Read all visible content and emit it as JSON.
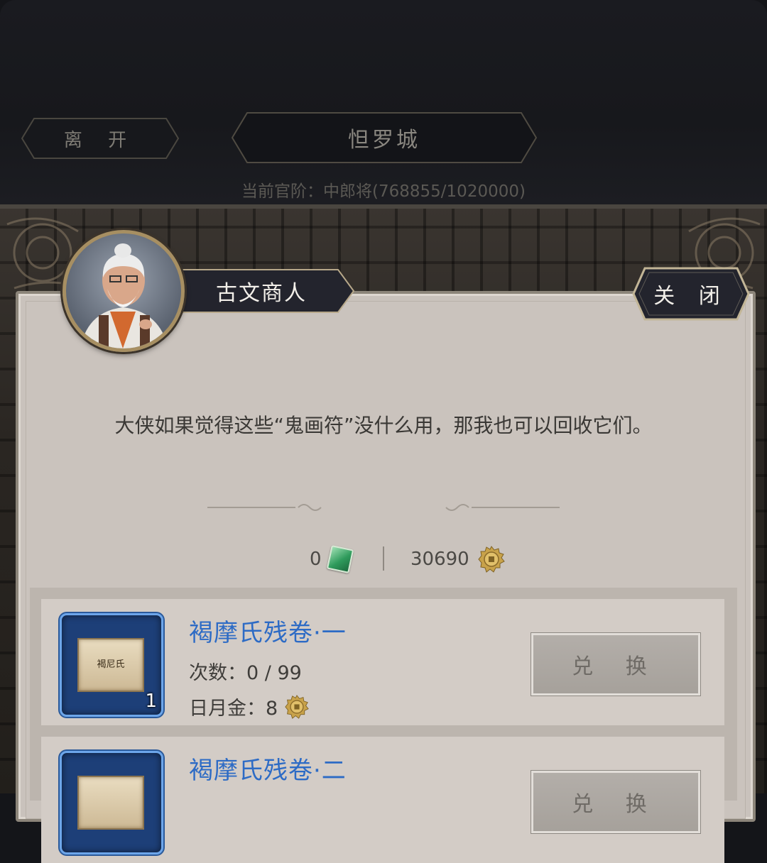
{
  "header": {
    "leave_label": "离 开",
    "city_name": "怛罗城",
    "rank_text": "当前官阶：中郎将(768855/1020000)"
  },
  "merchant": {
    "name": "古文商人",
    "close_label": "关 闭",
    "dialog": "大侠如果觉得这些“鬼画符”没什么用，那我也可以回收它们。"
  },
  "currency": {
    "jade": "0",
    "gold": "30690"
  },
  "items": [
    {
      "title": "褐摩氏残卷·一",
      "count_line": "次数：0 / 99",
      "price_line": "日月金：8",
      "quantity": "1",
      "paper_text": "褐尼氏",
      "button": "兑 换"
    },
    {
      "title": "褐摩氏残卷·二",
      "button": "兑 换"
    }
  ],
  "colors": {
    "item_title": "#2d6bc5",
    "panel_bg": "#c9c2bc",
    "icon_frame": "#6da6ea"
  }
}
